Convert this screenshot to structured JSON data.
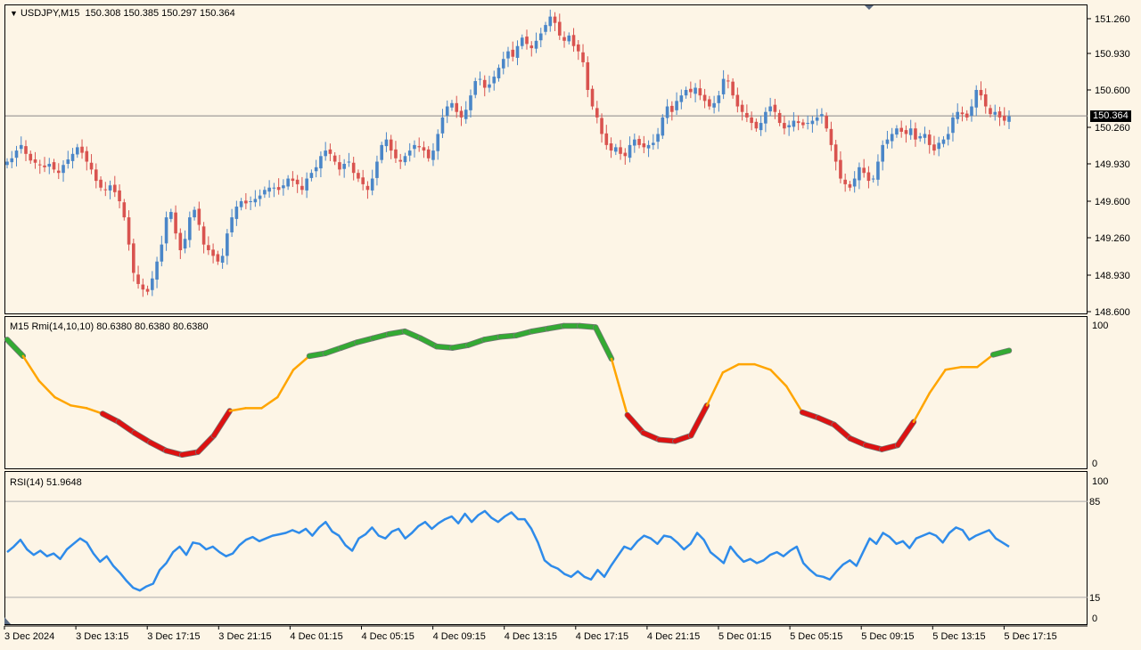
{
  "chart_data": [
    {
      "type": "candlestick",
      "title": "USDJPY,M15",
      "ohlc_header": "150.308 150.385 150.297 150.364",
      "current_price": "150.364",
      "y_ticks": [
        "151.260",
        "150.930",
        "150.600",
        "150.260",
        "149.930",
        "149.600",
        "149.260",
        "148.930",
        "148.600"
      ],
      "ylim": [
        148.58,
        151.38
      ],
      "closes": [
        149.95,
        149.98,
        150.05,
        150.1,
        150.02,
        149.96,
        149.94,
        149.92,
        149.9,
        149.93,
        149.88,
        149.85,
        149.92,
        149.97,
        150.02,
        150.08,
        150.03,
        149.95,
        149.88,
        149.78,
        149.72,
        149.7,
        149.74,
        149.68,
        149.6,
        149.45,
        149.2,
        148.95,
        148.85,
        148.8,
        148.78,
        148.9,
        149.05,
        149.2,
        149.45,
        149.5,
        149.3,
        149.15,
        149.25,
        149.45,
        149.52,
        149.38,
        149.2,
        149.15,
        149.1,
        149.05,
        149.1,
        149.3,
        149.45,
        149.55,
        149.6,
        149.58,
        149.6,
        149.62,
        149.65,
        149.7,
        149.72,
        149.72,
        149.7,
        149.74,
        149.8,
        149.78,
        149.75,
        149.7,
        149.8,
        149.85,
        149.9,
        150.0,
        150.05,
        150.02,
        149.95,
        149.88,
        149.93,
        149.95,
        149.85,
        149.8,
        149.75,
        149.7,
        149.8,
        149.95,
        150.1,
        150.15,
        150.05,
        149.98,
        149.95,
        150.0,
        150.05,
        150.1,
        150.08,
        150.05,
        149.98,
        150.05,
        150.2,
        150.35,
        150.45,
        150.48,
        150.4,
        150.35,
        150.42,
        150.55,
        150.68,
        150.7,
        150.62,
        150.65,
        150.72,
        150.8,
        150.88,
        150.95,
        150.9,
        151.0,
        151.08,
        151.02,
        150.98,
        151.05,
        151.12,
        151.2,
        151.28,
        151.22,
        151.1,
        151.05,
        151.1,
        151.0,
        150.95,
        150.85,
        150.6,
        150.45,
        150.35,
        150.2,
        150.1,
        150.05,
        150.08,
        150.02,
        150.0,
        150.1,
        150.15,
        150.1,
        150.08,
        150.1,
        150.12,
        150.2,
        150.35,
        150.45,
        150.4,
        150.5,
        150.55,
        150.6,
        150.58,
        150.62,
        150.55,
        150.5,
        150.45,
        150.48,
        150.55,
        150.7,
        150.68,
        150.55,
        150.45,
        150.4,
        150.35,
        150.3,
        150.25,
        150.3,
        150.4,
        150.45,
        150.4,
        150.3,
        150.25,
        150.28,
        150.32,
        150.3,
        150.28,
        150.3,
        150.32,
        150.35,
        150.38,
        150.25,
        150.1,
        149.95,
        149.8,
        149.75,
        149.72,
        149.8,
        149.9,
        149.85,
        149.78,
        149.8,
        149.95,
        150.1,
        150.15,
        150.2,
        150.25,
        150.22,
        150.2,
        150.25,
        150.15,
        150.18,
        150.2,
        150.1,
        150.05,
        150.12,
        150.15,
        150.2,
        150.35,
        150.4,
        150.38,
        150.35,
        150.45,
        150.6,
        150.55,
        150.45,
        150.38,
        150.4,
        150.35,
        150.32,
        150.36
      ]
    },
    {
      "type": "line",
      "title": "M15 Rmi(14,10,10) 80.6380 80.6380 80.6380",
      "y_ticks": [
        "100",
        "0"
      ],
      "ylim": [
        0,
        100
      ],
      "values": [
        90,
        78,
        60,
        48,
        42,
        40,
        36,
        30,
        22,
        15,
        9,
        6,
        8,
        20,
        38,
        40,
        40,
        48,
        68,
        78,
        80,
        84,
        88,
        91,
        94,
        96,
        91,
        85,
        84,
        86,
        90,
        92,
        93,
        96,
        98,
        100,
        100,
        99,
        76,
        35,
        22,
        17,
        16,
        20,
        42,
        66,
        72,
        72,
        68,
        56,
        37,
        33,
        28,
        18,
        13,
        10,
        13,
        30,
        51,
        68,
        70,
        70,
        79,
        82
      ],
      "strong_bullish_above": 78,
      "strong_bearish_below": 35,
      "colors": {
        "up": "#33AA33",
        "neutral": "#FFA500",
        "down": "#DD1111"
      }
    },
    {
      "type": "line",
      "title": "RSI(14) 51.9648",
      "y_ticks": [
        "100",
        "85",
        "15",
        "0"
      ],
      "levels": [
        85,
        15
      ],
      "ylim": [
        0,
        100
      ],
      "color": "#2E8BEA",
      "values": [
        48,
        52,
        57,
        50,
        46,
        49,
        45,
        47,
        43,
        50,
        54,
        58,
        55,
        47,
        41,
        45,
        38,
        33,
        27,
        22,
        20,
        23,
        25,
        35,
        40,
        48,
        52,
        46,
        55,
        54,
        50,
        52,
        48,
        45,
        47,
        53,
        57,
        59,
        56,
        58,
        60,
        61,
        62,
        64,
        62,
        65,
        60,
        66,
        70,
        63,
        60,
        53,
        49,
        58,
        61,
        66,
        60,
        58,
        63,
        65,
        58,
        62,
        67,
        70,
        65,
        69,
        72,
        74,
        69,
        76,
        70,
        75,
        78,
        73,
        70,
        74,
        77,
        72,
        72,
        65,
        55,
        42,
        38,
        36,
        32,
        30,
        34,
        30,
        28,
        35,
        30,
        38,
        45,
        52,
        50,
        56,
        60,
        58,
        54,
        60,
        59,
        55,
        50,
        54,
        62,
        57,
        48,
        44,
        40,
        52,
        46,
        41,
        43,
        40,
        42,
        46,
        48,
        45,
        49,
        52,
        40,
        35,
        31,
        30,
        28,
        34,
        39,
        42,
        38,
        48,
        58,
        54,
        62,
        59,
        54,
        56,
        51,
        58,
        60,
        62,
        60,
        55,
        62,
        66,
        64,
        57,
        60,
        62,
        64,
        58,
        55,
        52
      ]
    }
  ],
  "x_axis_labels": [
    "3 Dec 2024",
    "3 Dec 13:15",
    "3 Dec 17:15",
    "3 Dec 21:15",
    "4 Dec 01:15",
    "4 Dec 05:15",
    "4 Dec 09:15",
    "4 Dec 13:15",
    "4 Dec 17:15",
    "4 Dec 21:15",
    "5 Dec 01:15",
    "5 Dec 05:15",
    "5 Dec 09:15",
    "5 Dec 13:15",
    "5 Dec 17:15"
  ],
  "colors": {
    "background": "#FDF5E6",
    "bull": "#4A86C8",
    "bear": "#D9534F",
    "grid_line": "#888888"
  }
}
